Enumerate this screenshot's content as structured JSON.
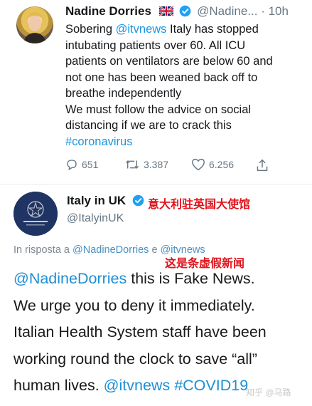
{
  "tweet1": {
    "author_name": "Nadine Dorries",
    "flag_icon": "uk-flag-icon",
    "handle": "@Nadine...",
    "separator": "·",
    "time": "10h",
    "lines": [
      {
        "plain": "Sobering ",
        "link": "@itvnews",
        "after": " Italy has stopped"
      },
      {
        "plain": "intubating patients over 60. All ICU"
      },
      {
        "plain": "patients on ventilators are below 60 and"
      },
      {
        "plain": "not one has been weaned back off to"
      },
      {
        "plain": "breathe independently"
      },
      {
        "plain": "We must follow the advice on social"
      },
      {
        "plain": "distancing if we are to crack this"
      },
      {
        "link": "#coronavirus"
      }
    ],
    "actions": {
      "reply_count": "651",
      "retweet_count": "3.387",
      "like_count": "6.256"
    },
    "colors": {
      "link": "#1b95e0",
      "meta": "#657786"
    }
  },
  "tweet2": {
    "author_name": "Italy in UK",
    "handle": "@ItalyinUK",
    "annotation_cn_1": "意大利驻英国大使馆",
    "reply_prefix": "In risposta a ",
    "reply_link_1": "@NadineDorries",
    "reply_mid": " e ",
    "reply_link_2": "@itvnews",
    "annotation_cn_2": "这是条虚假新闻",
    "lines": [
      {
        "link": "@NadineDorries",
        "after": " this is Fake News."
      },
      {
        "plain": "We urge you to deny it immediately."
      },
      {
        "plain": "Italian Health System staff have been"
      },
      {
        "plain": "working round the clock to save “all”"
      },
      {
        "plain": "human lives. ",
        "link": "@itvnews",
        "after": " ",
        "link2": "#COVID19"
      }
    ],
    "colors": {
      "annotation": "#e0131b"
    }
  },
  "watermark": "知乎 @马路"
}
